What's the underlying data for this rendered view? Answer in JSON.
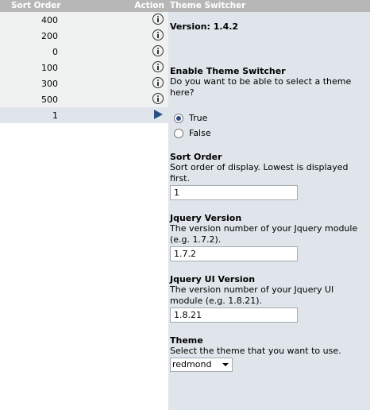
{
  "list": {
    "header": {
      "sort_order": "Sort Order",
      "action": "Action"
    },
    "rows": [
      {
        "sort": "400",
        "action_icon": "info-icon"
      },
      {
        "sort": "200",
        "action_icon": "info-icon"
      },
      {
        "sort": "0",
        "action_icon": "info-icon"
      },
      {
        "sort": "100",
        "action_icon": "info-icon"
      },
      {
        "sort": "300",
        "action_icon": "info-icon"
      },
      {
        "sort": "500",
        "action_icon": "info-icon"
      },
      {
        "sort": "1",
        "action_icon": "arrow-right-icon",
        "selected": true
      }
    ]
  },
  "panel": {
    "title": "Theme Switcher",
    "version": "Version: 1.4.2",
    "enable": {
      "title": "Enable Theme Switcher",
      "desc": "Do you want to be able to select a theme here?",
      "options": [
        {
          "label": "True",
          "checked": true
        },
        {
          "label": "False",
          "checked": false
        }
      ]
    },
    "sort_order": {
      "title": "Sort Order",
      "desc": "Sort order of display. Lowest is displayed first.",
      "value": "1"
    },
    "jquery_version": {
      "title": "Jquery Version",
      "desc": "The version number of your Jquery module (e.g. 1.7.2).",
      "value": "1.7.2"
    },
    "jquery_ui_version": {
      "title": "Jquery UI Version",
      "desc": "The version number of your Jquery UI module (e.g. 1.8.21).",
      "value": "1.8.21"
    },
    "theme": {
      "title": "Theme",
      "desc": "Select the theme that you want to use.",
      "value": "redmond"
    }
  },
  "colors": {
    "header_bg": "#b7b7b7",
    "panel_bg": "#dfe5ea",
    "row_bg": "#f0f1f1",
    "accent": "#2a4e86"
  }
}
